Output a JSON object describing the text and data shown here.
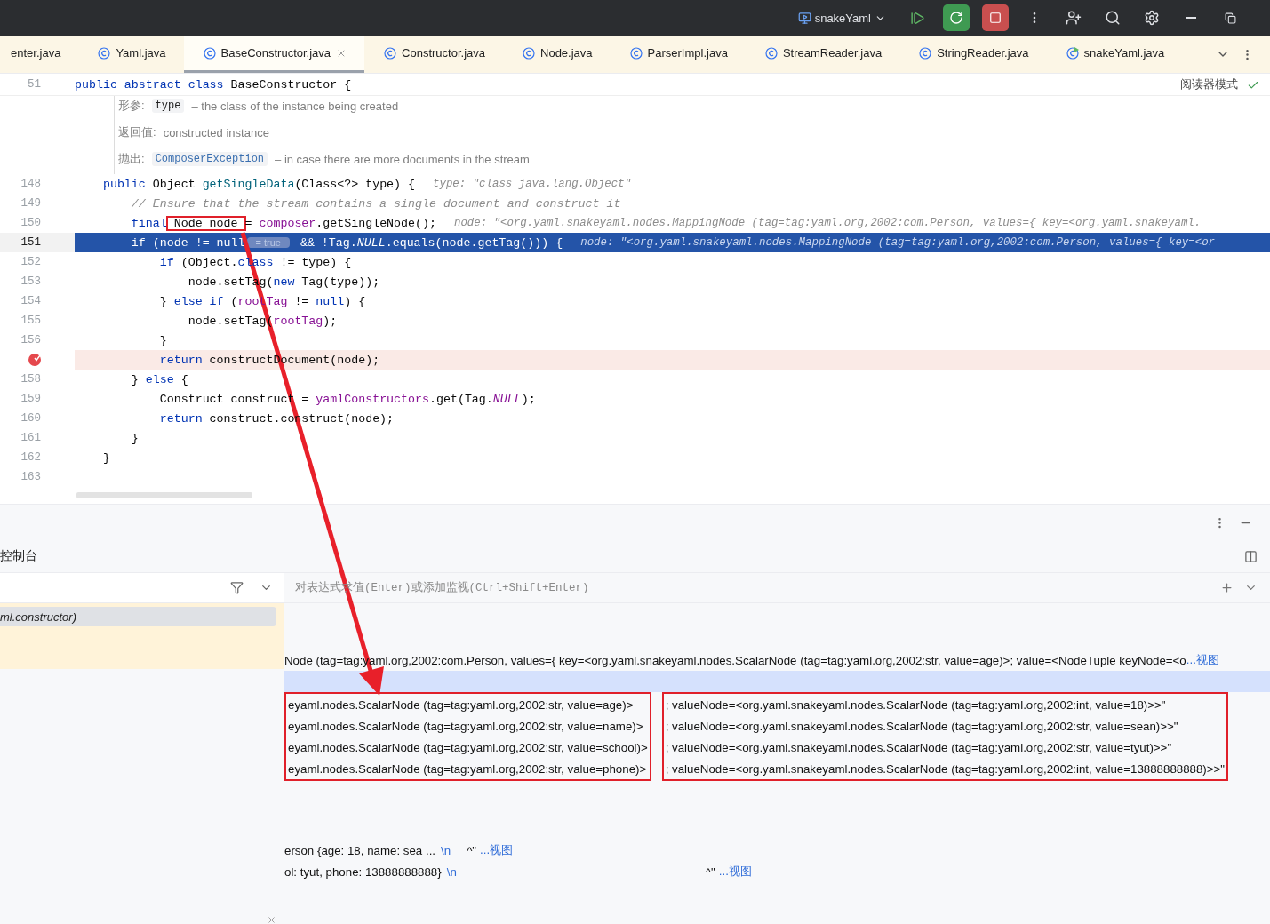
{
  "topbar": {
    "run_config": "snakeYaml"
  },
  "tabs": [
    {
      "label": "enter.java",
      "selected": false,
      "kind": "cut"
    },
    {
      "label": "Yaml.java",
      "selected": false,
      "kind": "class"
    },
    {
      "label": "BaseConstructor.java",
      "selected": true,
      "kind": "class",
      "closable": true
    },
    {
      "label": "Constructor.java",
      "selected": false,
      "kind": "class"
    },
    {
      "label": "Node.java",
      "selected": false,
      "kind": "class"
    },
    {
      "label": "ParserImpl.java",
      "selected": false,
      "kind": "class"
    },
    {
      "label": "StreamReader.java",
      "selected": false,
      "kind": "class"
    },
    {
      "label": "StringReader.java",
      "selected": false,
      "kind": "class"
    },
    {
      "label": "snakeYaml.java",
      "selected": false,
      "kind": "runnable"
    }
  ],
  "editor": {
    "sticky_line": {
      "number": "51",
      "tokens": [
        {
          "text": "public abstract class ",
          "kind": "keyword"
        },
        {
          "text": "BaseConstructor {",
          "kind": "plain"
        }
      ]
    },
    "reader_mode": "阅读器模式",
    "doc": [
      {
        "label": "形参:",
        "code": "type",
        "text": "– the class of the instance being created"
      },
      {
        "label": "返回值:",
        "text": "constructed instance"
      },
      {
        "label": "抛出:",
        "code": "ComposerException",
        "text": "– in case there are more documents in the stream"
      }
    ],
    "lines": [
      {
        "number": "148",
        "current": false,
        "breakpoint": false,
        "tokens": [
          {
            "text": "    public ",
            "kind": "keyword"
          },
          {
            "text": "Object ",
            "kind": "plain"
          },
          {
            "text": "getSingleData",
            "kind": "method"
          },
          {
            "text": "(Class<?> type) {",
            "kind": "plain"
          }
        ],
        "hint": "type: \"class java.lang.Object\""
      },
      {
        "number": "149",
        "current": false,
        "breakpoint": false,
        "tokens": [
          {
            "text": "        // Ensure that the stream contains a single document and construct it",
            "kind": "comment"
          }
        ]
      },
      {
        "number": "150",
        "current": false,
        "breakpoint": false,
        "tokens": [
          {
            "text": "        final",
            "kind": "keyword"
          },
          {
            "text": " Node node ",
            "kind": "boxed"
          },
          {
            "text": "= ",
            "kind": "plain"
          },
          {
            "text": "composer",
            "kind": "field"
          },
          {
            "text": ".getSingleNode();",
            "kind": "plain"
          }
        ],
        "hint": "node: \"<org.yaml.snakeyaml.nodes.MappingNode (tag=tag:yaml.org,2002:com.Person, values={ key=<org.yaml.snakeyaml."
      },
      {
        "number": "151",
        "current": true,
        "breakpoint": false,
        "tokens": [
          {
            "text": "        if (node != null",
            "kind": "plain"
          },
          {
            "text": "= true",
            "kind": "badge"
          },
          {
            "text": " && !Tag.",
            "kind": "plain"
          },
          {
            "text": "NULL",
            "kind": "static"
          },
          {
            "text": ".equals(node.getTag())) {",
            "kind": "plain"
          }
        ],
        "hint": "node: \"<org.yaml.snakeyaml.nodes.MappingNode (tag=tag:yaml.org,2002:com.Person, values={ key=<or"
      },
      {
        "number": "152",
        "current": false,
        "breakpoint": false,
        "tokens": [
          {
            "text": "            if ",
            "kind": "keyword"
          },
          {
            "text": "(Object.",
            "kind": "plain"
          },
          {
            "text": "class ",
            "kind": "keyword"
          },
          {
            "text": "!= type) {",
            "kind": "plain"
          }
        ]
      },
      {
        "number": "153",
        "current": false,
        "breakpoint": false,
        "tokens": [
          {
            "text": "                node.setTag(",
            "kind": "plain"
          },
          {
            "text": "new ",
            "kind": "keyword"
          },
          {
            "text": "Tag(type));",
            "kind": "plain"
          }
        ]
      },
      {
        "number": "154",
        "current": false,
        "breakpoint": false,
        "tokens": [
          {
            "text": "            } ",
            "kind": "plain"
          },
          {
            "text": "else if ",
            "kind": "keyword"
          },
          {
            "text": "(",
            "kind": "plain"
          },
          {
            "text": "rootTag ",
            "kind": "field"
          },
          {
            "text": "!= ",
            "kind": "plain"
          },
          {
            "text": "null",
            "kind": "keyword"
          },
          {
            "text": ") {",
            "kind": "plain"
          }
        ]
      },
      {
        "number": "155",
        "current": false,
        "breakpoint": false,
        "tokens": [
          {
            "text": "                node.setTag(",
            "kind": "plain"
          },
          {
            "text": "rootTag",
            "kind": "field"
          },
          {
            "text": ");",
            "kind": "plain"
          }
        ]
      },
      {
        "number": "156",
        "current": false,
        "breakpoint": false,
        "tokens": [
          {
            "text": "            }",
            "kind": "plain"
          }
        ]
      },
      {
        "current": false,
        "breakpoint": true,
        "tokens": [
          {
            "text": "            return ",
            "kind": "keyword"
          },
          {
            "text": "constructDocument(node);",
            "kind": "plain"
          }
        ]
      },
      {
        "number": "158",
        "current": false,
        "breakpoint": false,
        "tokens": [
          {
            "text": "        } ",
            "kind": "plain"
          },
          {
            "text": "else ",
            "kind": "keyword"
          },
          {
            "text": "{",
            "kind": "plain"
          }
        ]
      },
      {
        "number": "159",
        "current": false,
        "breakpoint": false,
        "tokens": [
          {
            "text": "            Construct construct = ",
            "kind": "plain"
          },
          {
            "text": "yamlConstructors",
            "kind": "field"
          },
          {
            "text": ".get(Tag.",
            "kind": "plain"
          },
          {
            "text": "NULL",
            "kind": "static"
          },
          {
            "text": ");",
            "kind": "plain"
          }
        ]
      },
      {
        "number": "160",
        "current": false,
        "breakpoint": false,
        "tokens": [
          {
            "text": "            return ",
            "kind": "keyword"
          },
          {
            "text": "construct.construct(node);",
            "kind": "plain"
          }
        ]
      },
      {
        "number": "161",
        "current": false,
        "breakpoint": false,
        "tokens": [
          {
            "text": "        }",
            "kind": "plain"
          }
        ]
      },
      {
        "number": "162",
        "current": false,
        "breakpoint": false,
        "tokens": [
          {
            "text": "    }",
            "kind": "plain"
          }
        ]
      },
      {
        "number": "163",
        "current": false,
        "breakpoint": false
      }
    ]
  },
  "debugger": {
    "title": "控制台",
    "frames": [
      {
        "label": "ml.constructor)",
        "selected": true
      }
    ],
    "eval_placeholder": "对表达式求值(Enter)或添加监视(Ctrl+Shift+Enter)",
    "items": [
      {
        "kind": "value",
        "text": "Node (tag=tag:yaml.org,2002:com.Person, values={ key=<org.yaml.snakeyaml.nodes.ScalarNode (tag=tag:yaml.org,2002:str, value=age)>; value=<NodeTuple keyNode=<o",
        "link": "...视图"
      },
      {
        "kind": "blank",
        "selected": true
      },
      {
        "kind": "group",
        "left": [
          "eyaml.nodes.ScalarNode (tag=tag:yaml.org,2002:str, value=age)>",
          "eyaml.nodes.ScalarNode (tag=tag:yaml.org,2002:str, value=name)>",
          "eyaml.nodes.ScalarNode (tag=tag:yaml.org,2002:str, value=school)>",
          "eyaml.nodes.ScalarNode (tag=tag:yaml.org,2002:str, value=phone)>"
        ],
        "right": [
          "; valueNode=<org.yaml.snakeyaml.nodes.ScalarNode (tag=tag:yaml.org,2002:int, value=18)>>\"",
          "; valueNode=<org.yaml.snakeyaml.nodes.ScalarNode (tag=tag:yaml.org,2002:str, value=sean)>>\"",
          "; valueNode=<org.yaml.snakeyaml.nodes.ScalarNode (tag=tag:yaml.org,2002:str, value=tyut)>>\"",
          "; valueNode=<org.yaml.snakeyaml.nodes.ScalarNode (tag=tag:yaml.org,2002:int, value=13888888888)>>\""
        ]
      },
      {
        "kind": "string",
        "text": "erson {age: 18, name: sea ...",
        "escape": "\\n",
        "quote": "^\"",
        "link": "...视图"
      },
      {
        "kind": "string",
        "text": "ol: tyut, phone: 13888888888}",
        "escape": "\\n",
        "quote": "^\"",
        "link": "...视图"
      }
    ]
  }
}
